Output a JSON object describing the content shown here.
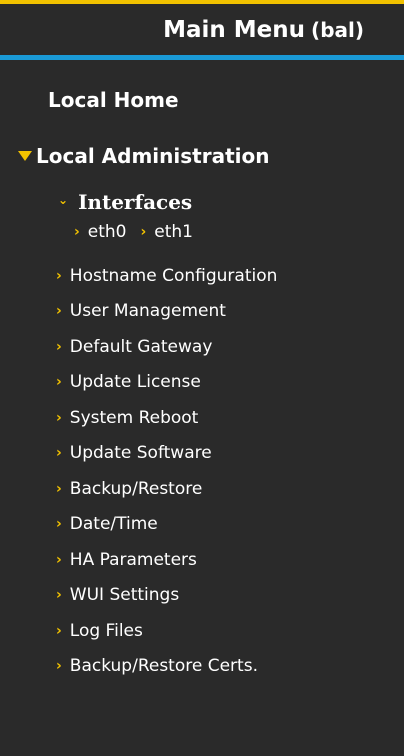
{
  "header": {
    "title": "Main Menu",
    "subtitle": "(bal)"
  },
  "menu": {
    "local_home": "Local Home",
    "local_administration": "Local Administration",
    "interfaces": {
      "label": "Interfaces",
      "items": [
        "eth0",
        "eth1"
      ]
    },
    "items": [
      "Hostname Configuration",
      "User Management",
      "Default Gateway",
      "Update License",
      "System Reboot",
      "Update Software",
      "Backup/Restore",
      "Date/Time",
      "HA Parameters",
      "WUI Settings",
      "Log Files",
      "Backup/Restore Certs."
    ]
  },
  "colors": {
    "accent": "#f2c200",
    "header_border": "#1a9ad6",
    "background": "#2a2a2a",
    "text": "#ffffff"
  }
}
